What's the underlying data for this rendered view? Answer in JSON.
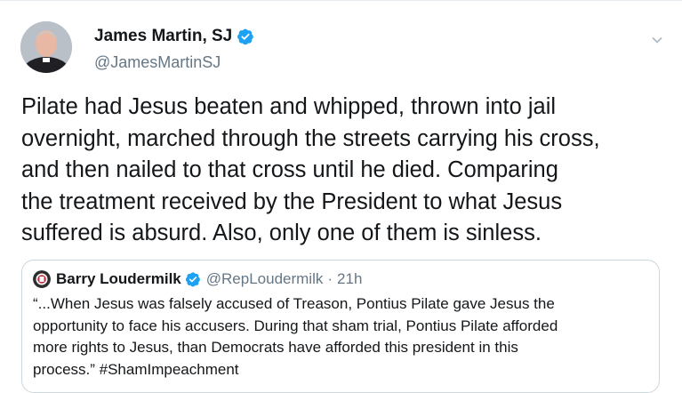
{
  "author": {
    "name": "James Martin, SJ",
    "handle": "@JamesMartinSJ",
    "verified_icon": "verified-badge-icon",
    "menu_icon": "chevron-down-icon"
  },
  "tweet": {
    "text": "Pilate had Jesus beaten and whipped, thrown into jail\novernight, marched through the streets carrying his cross,\nand then nailed to that cross until he died. Comparing\nthe treatment received by the President to what Jesus\nsuffered is absurd. Also, only one of them is sinless."
  },
  "quoted_tweet": {
    "name": "Barry Loudermilk",
    "handle": "@RepLoudermilk",
    "separator": "·",
    "time": "21h",
    "text": "“...When Jesus was falsely accused of Treason, Pontius Pilate gave Jesus the\nopportunity to face his accusers. During that sham trial, Pontius Pilate afforded\nmore rights to Jesus, than Democrats have afforded this president in this\nprocess.” #ShamImpeachment"
  },
  "colors": {
    "text_primary": "#14171a",
    "text_secondary": "#657786",
    "verified_blue": "#1da1f2",
    "border": "#ccd6dd"
  }
}
